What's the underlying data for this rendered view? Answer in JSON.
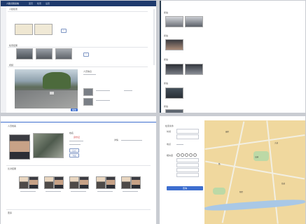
{
  "app": {
    "title": "人脸识别系统",
    "nav": [
      "首页",
      "检索",
      "设置"
    ]
  },
  "top_left": {
    "section1_label": "人脸检索",
    "section2_label": "检索结果",
    "section3_label": "视频",
    "info_label": "人员信息",
    "play_button": "播放"
  },
  "top_right": {
    "sections": [
      "抓拍",
      "抓拍",
      "抓拍",
      "抓拍",
      "抓拍",
      "抓拍"
    ]
  },
  "bottom_left": {
    "tab_label": "人员档案",
    "name_label": "姓名",
    "id_tag": "身份证",
    "action_label": "详情",
    "compare_button": "比对",
    "export_button": "导出",
    "results_label": "比对结果",
    "footer_label": "更多"
  },
  "bottom_right": {
    "form_title": "检索条件",
    "labels": [
      "时间",
      "地点",
      "相似度",
      "性别",
      "年龄",
      "设备"
    ],
    "search_button": "查询",
    "map_labels": [
      "城区",
      "公园",
      "大道",
      "路",
      "街道",
      "新区"
    ]
  },
  "colors": {
    "nav": "#1e3a6d",
    "accent": "#3d6ecf",
    "map": "#f0d89e"
  }
}
